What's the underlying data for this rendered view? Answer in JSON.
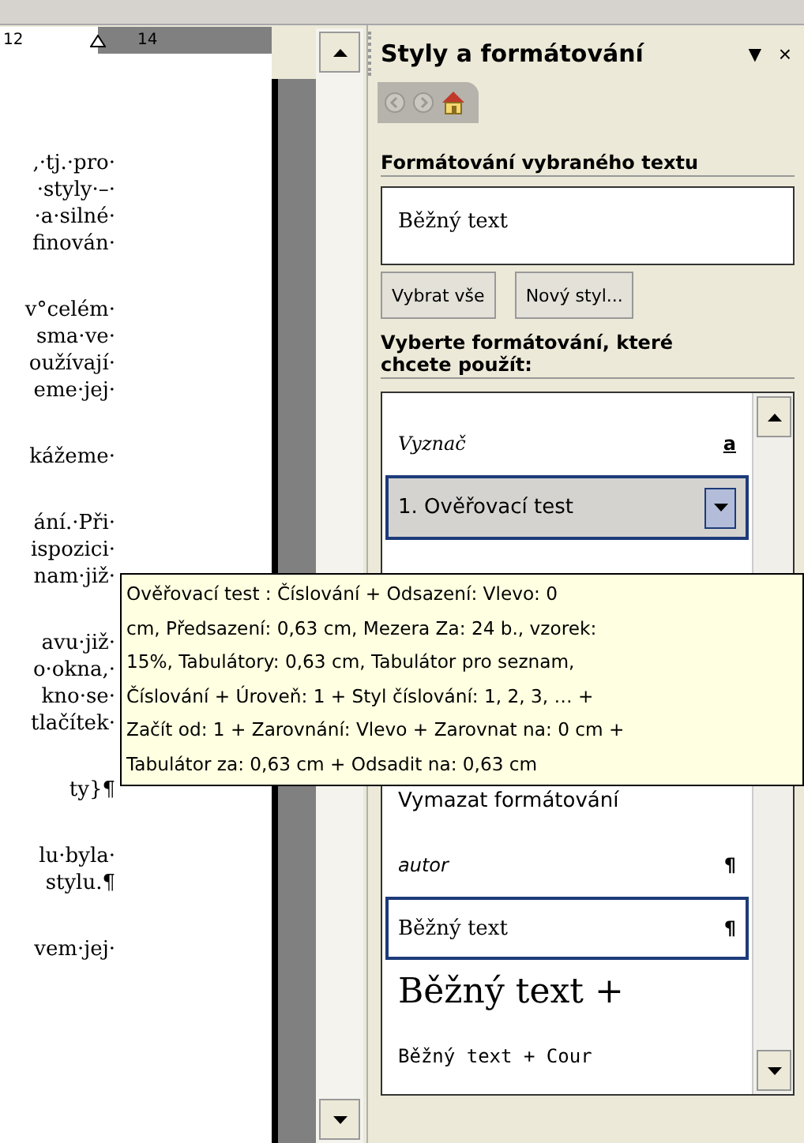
{
  "ruler": {
    "labels": [
      "12",
      "14"
    ]
  },
  "document": {
    "paragraphs": [
      [
        ",·tj.·pro·",
        "·styly·–·",
        "·a·silné·",
        "finován·"
      ],
      [
        "v°celém·",
        "sma·ve·",
        "oužívají·",
        "eme·jej·"
      ],
      [
        "kážeme·"
      ],
      [
        "ání.·Při·",
        "ispozici·",
        "nam·již·"
      ],
      [
        "avu·již·",
        "o·okna,·",
        "kno·se·",
        "tlačítek·"
      ],
      [
        "ty}¶"
      ],
      [
        "lu·byla·",
        "stylu.¶"
      ],
      [
        "vem·jej·"
      ]
    ]
  },
  "pane": {
    "title": "Styly a formátování",
    "menu_glyph": "▼",
    "close_glyph": "×",
    "section_1": "Formátování vybraného textu",
    "current_style": "Běžný text",
    "buttons": [
      "Vybrat vše",
      "Nový styl..."
    ],
    "section_2": "Vyberte formátování, které chcete použít:",
    "styles": [
      {
        "label": "Vyznač",
        "kind": "italic-serif",
        "mark": "a",
        "selected": false,
        "current": false
      },
      {
        "label": "1. Ověřovací test",
        "kind": "plain",
        "selected": true,
        "current": false
      },
      {
        "label": "Vymazat formátování",
        "kind": "plain",
        "selected": false,
        "current": false
      },
      {
        "label": "autor",
        "kind": "italic",
        "mark": "¶",
        "selected": false,
        "current": false
      },
      {
        "label": "Běžný text",
        "kind": "serif",
        "mark": "¶",
        "selected": false,
        "current": true
      },
      {
        "label": "Běžný text +",
        "kind": "serif-large",
        "selected": false,
        "current": false
      },
      {
        "label": "Běžný text + Cour",
        "kind": "mono",
        "selected": false,
        "current": false
      }
    ]
  },
  "tooltip": {
    "lines": [
      "Ověřovací test : Číslování + Odsazení: Vlevo:  0",
      "cm, Předsazení:  0,63 cm, Mezera Za:  24 b., vzorek:",
      "15%, Tabulátory:  0,63 cm, Tabulátor pro seznam,",
      "Číslování + Úroveň: 1 + Styl číslování: 1, 2, 3, … +",
      "Začít od: 1 + Zarovnání: Vlevo + Zarovnat na:  0 cm +",
      "Tabulátor za:  0,63 cm + Odsadit na:  0,63 cm"
    ]
  }
}
